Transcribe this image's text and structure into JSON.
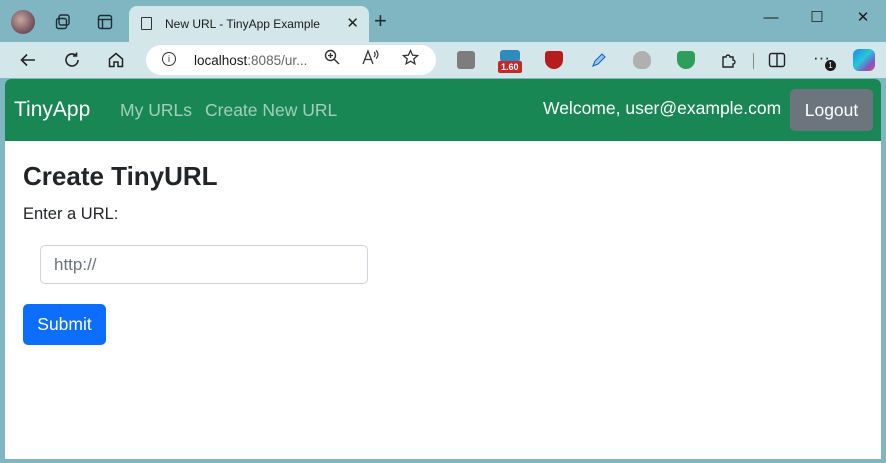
{
  "browser": {
    "tab_title": "New URL - TinyApp Example",
    "tab_close": "✕",
    "new_tab": "+",
    "window_controls": {
      "minimize": "—",
      "maximize": "☐",
      "close": "✕"
    },
    "address": {
      "host": "localhost",
      "rest": ":8085/ur..."
    },
    "extensions": {
      "badge_label": "1.60",
      "notification_count": "1"
    }
  },
  "navbar": {
    "brand": "TinyApp",
    "links": [
      "My URLs",
      "Create New URL"
    ],
    "welcome": "Welcome, user@example.com",
    "logout_label": "Logout",
    "color": "#198754"
  },
  "form": {
    "heading": "Create TinyURL",
    "label": "Enter a URL:",
    "placeholder": "http://",
    "submit_label": "Submit",
    "submit_color": "#0d6efd"
  }
}
